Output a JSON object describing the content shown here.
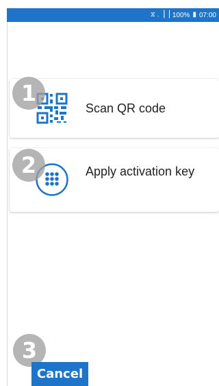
{
  "status_bar": {
    "signal": "⧖ .▕▕",
    "battery_percent": "100%",
    "battery_icon": "▮",
    "time": "07:00"
  },
  "options": [
    {
      "label": "Scan QR code",
      "step": "1",
      "icon": "qr-code-icon"
    },
    {
      "label": "Apply activation key",
      "step": "2",
      "icon": "keypad-icon"
    }
  ],
  "cancel": {
    "label": "Cancel",
    "step": "3"
  },
  "colors": {
    "accent": "#1e74c8",
    "badge": "#a0a0a0",
    "background": "#ffffff"
  }
}
